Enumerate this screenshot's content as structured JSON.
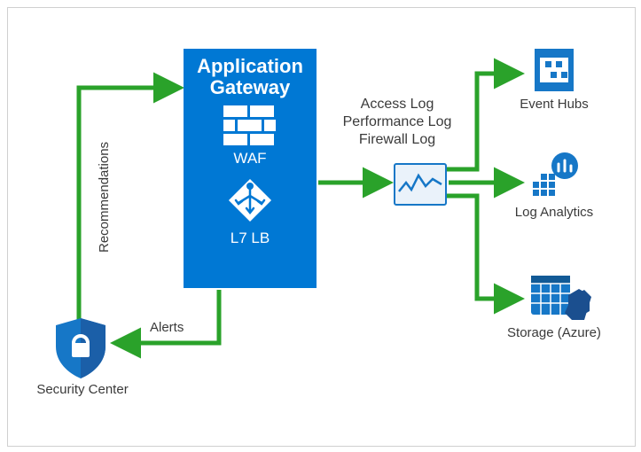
{
  "diagram": {
    "app_gateway": {
      "title_line1": "Application",
      "title_line2": "Gateway",
      "waf_label": "WAF",
      "lb_label": "L7 LB"
    },
    "logs": {
      "line1": "Access Log",
      "line2": "Performance Log",
      "line3": "Firewall Log"
    },
    "services": {
      "event_hubs": "Event Hubs",
      "log_analytics": "Log Analytics",
      "storage": "Storage (Azure)"
    },
    "security_center": {
      "label": "Security Center",
      "recommendations": "Recommendations",
      "alerts": "Alerts"
    },
    "colors": {
      "azure_blue": "#0078d4",
      "arrow_green": "#2aa22a",
      "icon_blue": "#1677c7",
      "dark_blue": "#1b4f8f"
    }
  }
}
